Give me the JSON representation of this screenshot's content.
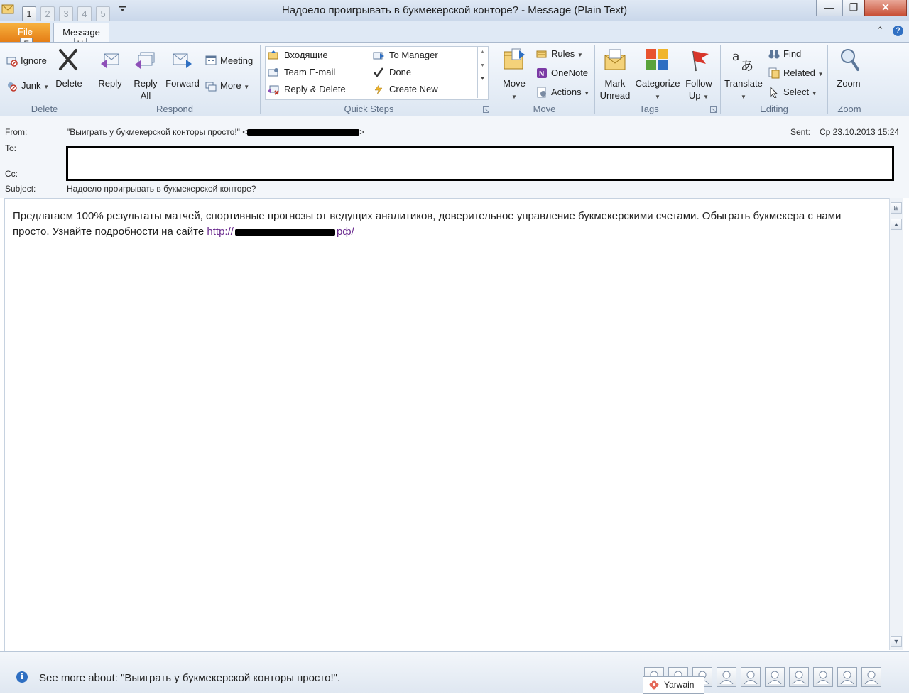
{
  "window": {
    "title": "Надоело проигрывать в букмекерской конторе?  -  Message (Plain Text)",
    "quick_access_keytips": [
      "1",
      "2",
      "3",
      "4",
      "5"
    ],
    "minimize_glyph": "—",
    "maximize_glyph": "❐",
    "close_glyph": "✕"
  },
  "tabs": {
    "file_label": "File",
    "message_label": "Message",
    "file_keytip": "F",
    "message_keytip": "H",
    "collapse_glyph": "⌃",
    "help_glyph": "?"
  },
  "ribbon": {
    "delete_group": {
      "label": "Delete",
      "ignore": "Ignore",
      "junk": "Junk",
      "delete": "Delete"
    },
    "respond_group": {
      "label": "Respond",
      "reply": "Reply",
      "reply_all_line1": "Reply",
      "reply_all_line2": "All",
      "forward": "Forward",
      "meeting": "Meeting",
      "more": "More"
    },
    "quick_steps_group": {
      "label": "Quick Steps",
      "items": [
        "Входящие",
        "Team E-mail",
        "Reply & Delete",
        "To Manager",
        "Done",
        "Create New"
      ]
    },
    "move_group": {
      "label": "Move",
      "move": "Move",
      "rules": "Rules",
      "onenote": "OneNote",
      "actions": "Actions"
    },
    "tags_group": {
      "label": "Tags",
      "mark_line1": "Mark",
      "mark_line2": "Unread",
      "categorize": "Categorize",
      "follow_line1": "Follow",
      "follow_line2": "Up"
    },
    "editing_group": {
      "label": "Editing",
      "translate": "Translate",
      "find": "Find",
      "related": "Related",
      "select": "Select"
    },
    "zoom_group": {
      "label": "Zoom",
      "zoom": "Zoom"
    }
  },
  "header": {
    "from_label": "From:",
    "from_name": "\"Выиграть у букмекерской конторы  просто!\" <",
    "from_end": ">",
    "sent_label": "Sent:",
    "sent_value": "Ср 23.10.2013 15:24",
    "to_label": "To:",
    "cc_label": "Cc:",
    "subject_label": "Subject:",
    "subject_value": "Надоело проигрывать в букмекерской конторе?"
  },
  "message": {
    "body_text": "Предлагаем 100% результаты матчей, спортивные прогнозы от ведущих аналитиков, доверительное управление букмекерскими счетами. Обыграть букмекера с нами просто. Узнайте подробности на сайте ",
    "link_prefix": "http://",
    "link_suffix": "рф/"
  },
  "people_pane": {
    "see_more": "See more about: \"Выиграть у букмекерской конторы  просто!\".",
    "contact_name": "Yarwain",
    "info_glyph": "i"
  },
  "colors": {
    "file_tab": "#e57e16",
    "ribbon_bg": "#dce6f2",
    "link": "#6b2c8f"
  }
}
